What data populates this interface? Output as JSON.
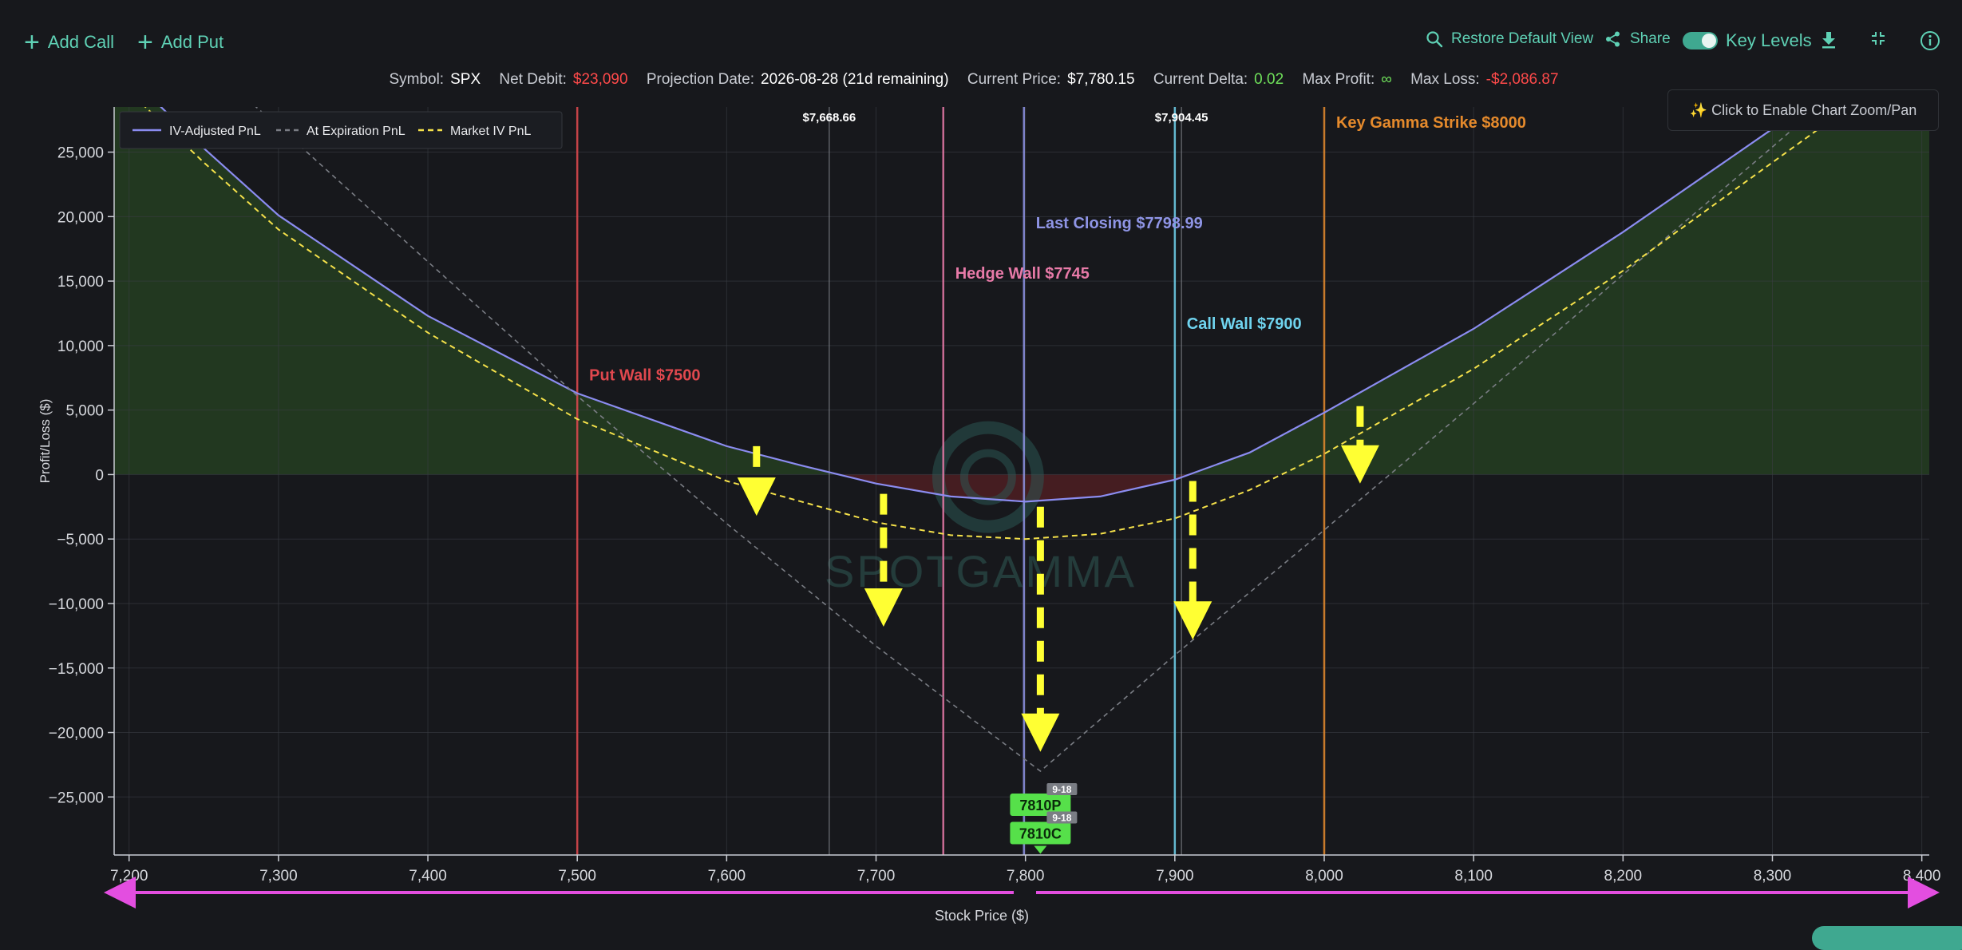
{
  "toolbar": {
    "add_call": "Add Call",
    "add_put": "Add Put",
    "restore": "Restore Default View",
    "share": "Share",
    "key_levels": "Key Levels"
  },
  "info": {
    "symbol_label": "Symbol:",
    "symbol": "SPX",
    "net_debit_label": "Net Debit:",
    "net_debit": "$23,090",
    "projection_label": "Projection Date:",
    "projection": "2026-08-28 (21d remaining)",
    "price_label": "Current Price:",
    "price": "$7,780.15",
    "delta_label": "Current Delta:",
    "delta": "0.02",
    "max_profit_label": "Max Profit:",
    "max_profit": "∞",
    "max_loss_label": "Max Loss:",
    "max_loss": "-$2,086.87"
  },
  "zoom_hint": "✨ Click to Enable Chart Zoom/Pan",
  "watermark": "SPOTGAMMA",
  "colors": {
    "iv_adjusted": "#8b8cf0",
    "expiration": "#7a7d84",
    "market_iv": "#f5e14a",
    "put_wall": "#e0484e",
    "hedge_wall": "#e87aa8",
    "last_closing": "#8f95e6",
    "call_wall": "#6fd3ee",
    "key_gamma": "#e58a2c",
    "profit_fill": "#233a21",
    "loss_fill": "#4a1e22",
    "range_arrow": "#e34ee0",
    "arrow_yellow": "#ffff33"
  },
  "chart_data": {
    "type": "line",
    "xlabel": "Stock Price ($)",
    "ylabel": "Profit/Loss ($)",
    "xlim": [
      7190,
      8405
    ],
    "ylim": [
      -29500,
      28500
    ],
    "x_ticks": [
      7200,
      7300,
      7400,
      7500,
      7600,
      7700,
      7800,
      7900,
      8000,
      8100,
      8200,
      8300,
      8400
    ],
    "x_tick_labels": [
      "7,200",
      "7,300",
      "7,400",
      "7,500",
      "7,600",
      "7,700",
      "7,800",
      "7,900",
      "8,000",
      "8,100",
      "8,200",
      "8,300",
      "8,400"
    ],
    "y_ticks": [
      25000,
      20000,
      15000,
      10000,
      5000,
      0,
      -5000,
      -10000,
      -15000,
      -20000,
      -25000
    ],
    "y_tick_labels": [
      "25,000",
      "20,000",
      "15,000",
      "10,000",
      "5,000",
      "0",
      "−5,000",
      "−10,000",
      "−15,000",
      "−20,000",
      "−25,000"
    ],
    "grid": true,
    "legend_position": "top-left",
    "series": [
      {
        "name": "IV-Adjusted PnL",
        "style": "solid",
        "x": [
          7190,
          7250,
          7300,
          7400,
          7500,
          7600,
          7650,
          7700,
          7750,
          7800,
          7850,
          7900,
          7950,
          8000,
          8100,
          8200,
          8300,
          8405
        ],
        "y": [
          32000,
          25300,
          20100,
          12300,
          6300,
          2200,
          700,
          -700,
          -1700,
          -2100,
          -1700,
          -400,
          1700,
          4800,
          11300,
          18800,
          26800,
          35000
        ]
      },
      {
        "name": "At Expiration PnL",
        "style": "dashed",
        "x": [
          7190,
          7300,
          7400,
          7500,
          7600,
          7700,
          7810,
          7900,
          8000,
          8100,
          8200,
          8300,
          8405
        ],
        "y": [
          38000,
          27000,
          16500,
          6100,
          -3800,
          -13300,
          -23000,
          -14000,
          -4300,
          5500,
          15500,
          25400,
          36000
        ]
      },
      {
        "name": "Market IV PnL",
        "style": "dashed",
        "x": [
          7190,
          7250,
          7300,
          7400,
          7500,
          7600,
          7700,
          7750,
          7800,
          7850,
          7900,
          7950,
          8000,
          8100,
          8200,
          8300,
          8405
        ],
        "y": [
          30800,
          24200,
          19000,
          11000,
          4300,
          -500,
          -3700,
          -4700,
          -5000,
          -4600,
          -3400,
          -1200,
          1600,
          8200,
          15800,
          24200,
          33000
        ]
      }
    ],
    "vertical_lines": [
      {
        "x": 7500,
        "label": "Put Wall $7500",
        "label_x": 7508,
        "label_y": 7300,
        "color": "#e0484e"
      },
      {
        "x": 7668.66,
        "label": "$7,668.66",
        "label_y": 27400,
        "color": "#7a7d84",
        "small": true
      },
      {
        "x": 7745,
        "label": "Hedge Wall $7745",
        "label_x": 7753,
        "label_y": 15200,
        "color": "#e87aa8"
      },
      {
        "x": 7798.99,
        "label": "Last Closing $7798.99",
        "label_x": 7807,
        "label_y": 19100,
        "color": "#8f95e6"
      },
      {
        "x": 7900,
        "label": "Call Wall $7900",
        "label_x": 7908,
        "label_y": 11300,
        "color": "#6fd3ee"
      },
      {
        "x": 7904.45,
        "label": "$7,904.45",
        "label_y": 27400,
        "color": "#7a7d84",
        "small": true
      },
      {
        "x": 8000,
        "label": "Key Gamma Strike $8000",
        "label_x": 8008,
        "label_y": 26900,
        "color": "#e58a2c"
      }
    ],
    "annotations": [
      {
        "text": "7810P",
        "badge": "9-18",
        "x": 7810,
        "y": -25600
      },
      {
        "text": "7810C",
        "badge": "9-18",
        "x": 7810,
        "y": -27800
      }
    ],
    "down_arrows": [
      {
        "x": 7620,
        "y_from": 2200,
        "y_to": -3200
      },
      {
        "x": 7705,
        "y_from": -1500,
        "y_to": -11800
      },
      {
        "x": 7810,
        "y_from": -2500,
        "y_to": -21500
      },
      {
        "x": 7912,
        "y_from": -500,
        "y_to": -12800
      },
      {
        "x": 8024,
        "y_from": 5300,
        "y_to": -700
      }
    ]
  }
}
